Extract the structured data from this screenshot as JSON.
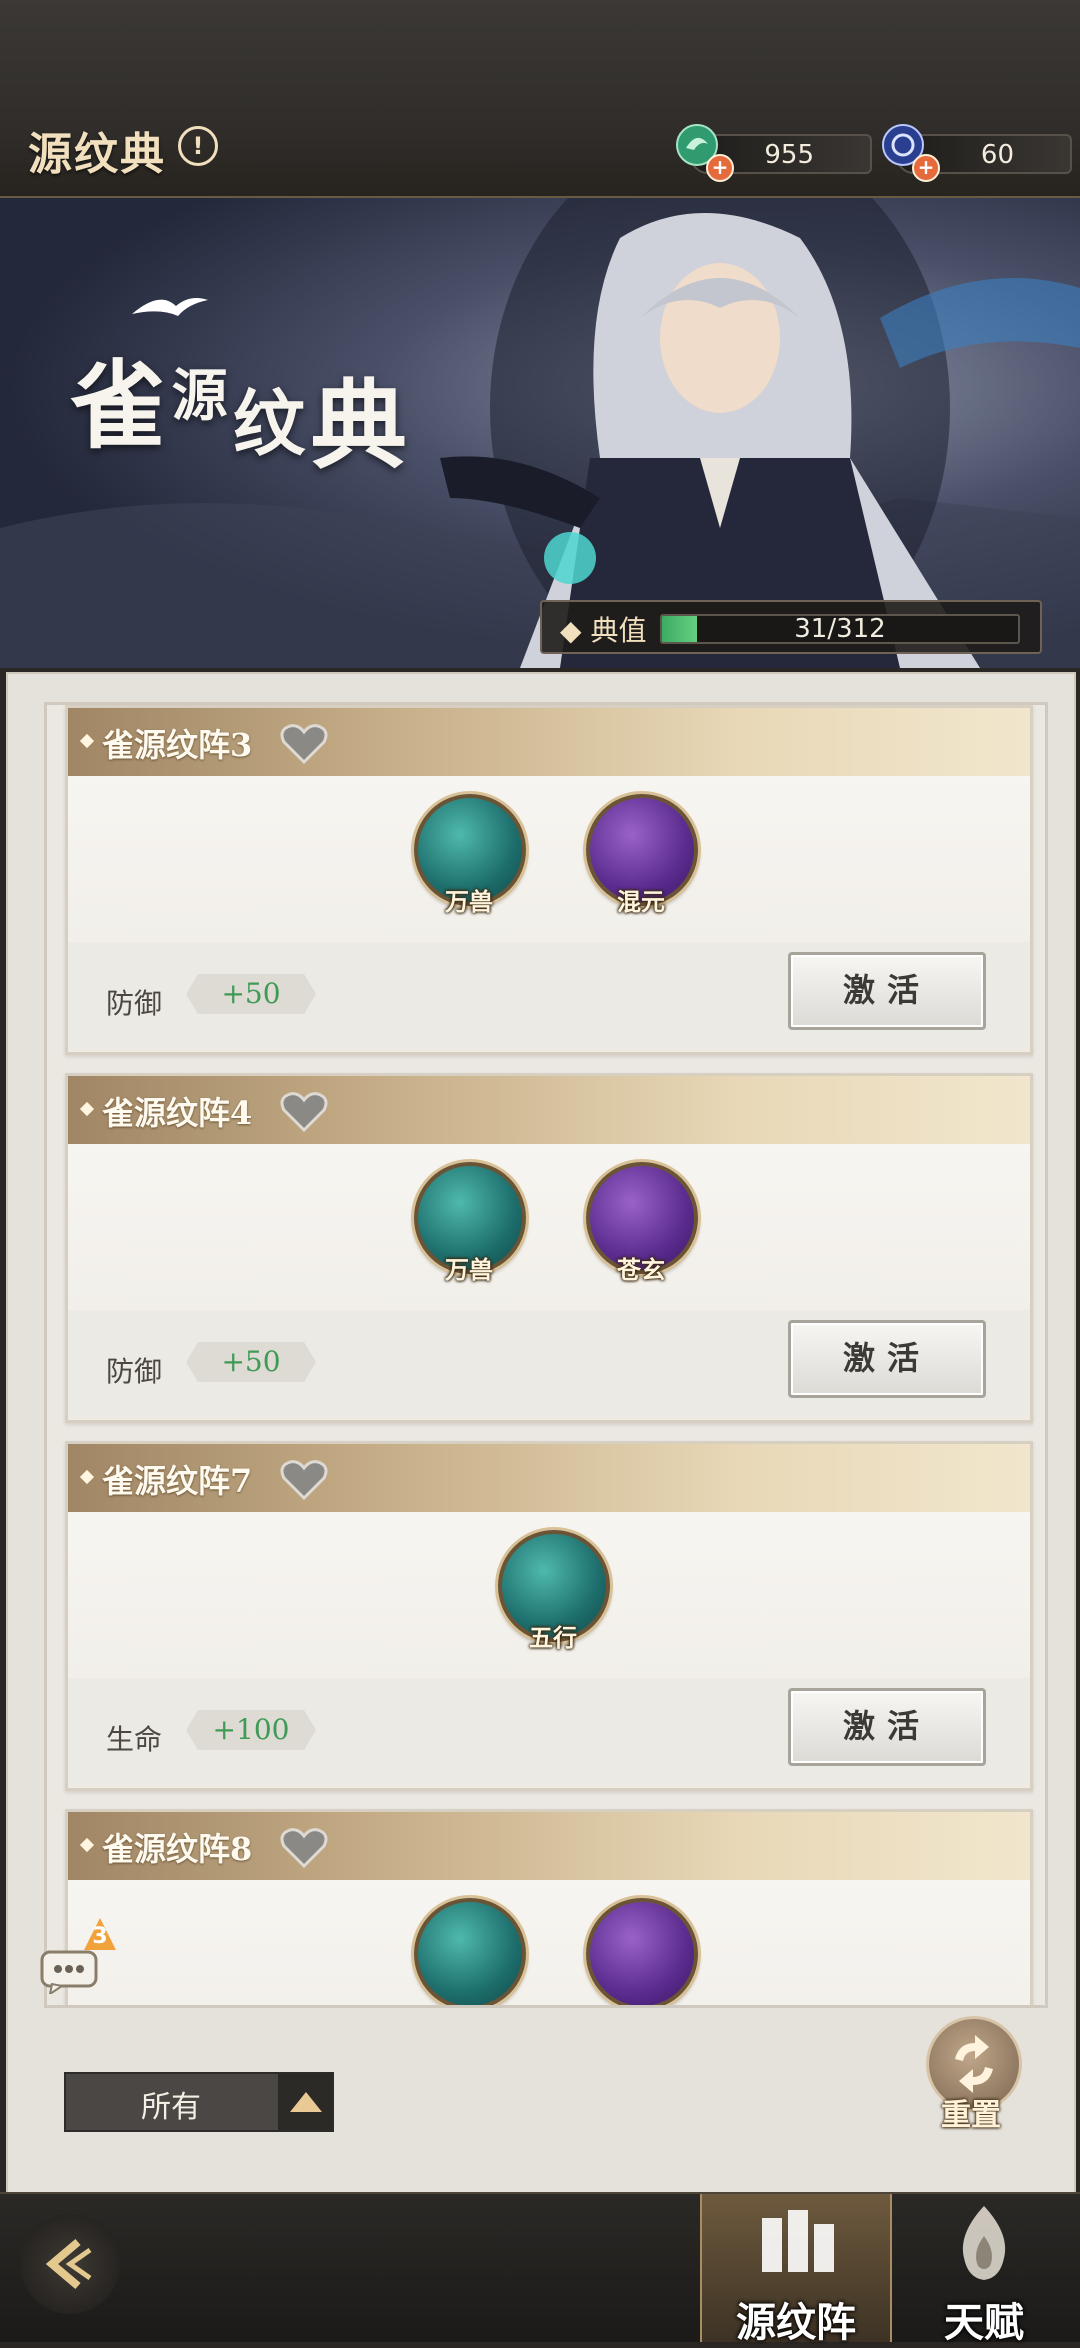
{
  "header": {
    "title": "源纹典",
    "info_symbol": "!",
    "currency_1": {
      "value": "955",
      "icon": "jade-token-icon",
      "plus": "+"
    },
    "currency_2": {
      "value": "60",
      "icon": "blue-coin-icon",
      "plus": "+"
    }
  },
  "banner": {
    "title_chars": [
      "雀",
      "源",
      "纹",
      "典"
    ],
    "progress_label": "典值",
    "progress_text": "31/312",
    "progress_current": 31,
    "progress_max": 312
  },
  "cards": [
    {
      "title": "雀源纹阵3",
      "beasts": [
        {
          "name": "万兽",
          "color": "teal"
        },
        {
          "name": "混元",
          "color": "purple"
        }
      ],
      "stat_label": "防御",
      "stat_value": "+50",
      "button": "激活"
    },
    {
      "title": "雀源纹阵4",
      "beasts": [
        {
          "name": "万兽",
          "color": "teal"
        },
        {
          "name": "苍玄",
          "color": "purple"
        }
      ],
      "stat_label": "防御",
      "stat_value": "+50",
      "button": "激活"
    },
    {
      "title": "雀源纹阵7",
      "beasts": [
        {
          "name": "五行",
          "color": "teal"
        }
      ],
      "stat_label": "生命",
      "stat_value": "+100",
      "button": "激活"
    },
    {
      "title": "雀源纹阵8",
      "beasts": [
        {
          "name": "",
          "color": "teal"
        },
        {
          "name": "",
          "color": "purple"
        }
      ],
      "stat_label": "",
      "stat_value": "",
      "button": ""
    }
  ],
  "filter": {
    "label": "所有"
  },
  "reset": {
    "label": "重置"
  },
  "chat": {
    "badge": "3"
  },
  "nav": {
    "tab_1": "源纹阵",
    "tab_2": "天赋"
  },
  "colors": {
    "accent_gold": "#e9c994",
    "stat_green": "#3e9a54",
    "progress_green": "#3cab64"
  }
}
